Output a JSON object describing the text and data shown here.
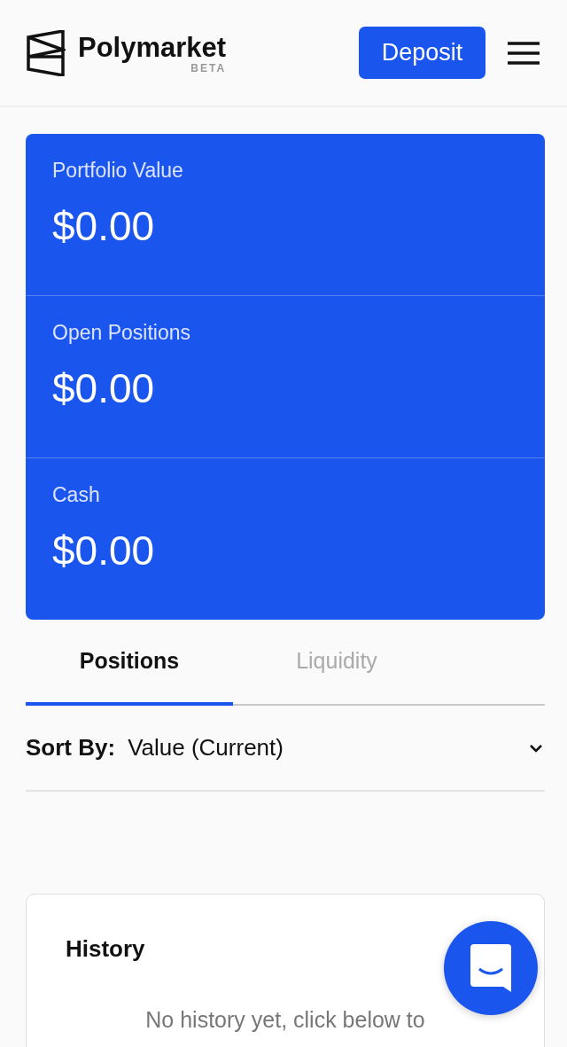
{
  "header": {
    "brand": "Polymarket",
    "badge": "BETA",
    "deposit_button": "Deposit"
  },
  "portfolio": [
    {
      "label": "Portfolio Value",
      "value": "$0.00"
    },
    {
      "label": "Open Positions",
      "value": "$0.00"
    },
    {
      "label": "Cash",
      "value": "$0.00"
    }
  ],
  "tabs": [
    {
      "label": "Positions",
      "selected": true
    },
    {
      "label": "Liquidity",
      "selected": false
    }
  ],
  "sort": {
    "label": "Sort By:",
    "value": "Value (Current)"
  },
  "history": {
    "title": "History",
    "empty_text": "No history yet, click below to"
  }
}
